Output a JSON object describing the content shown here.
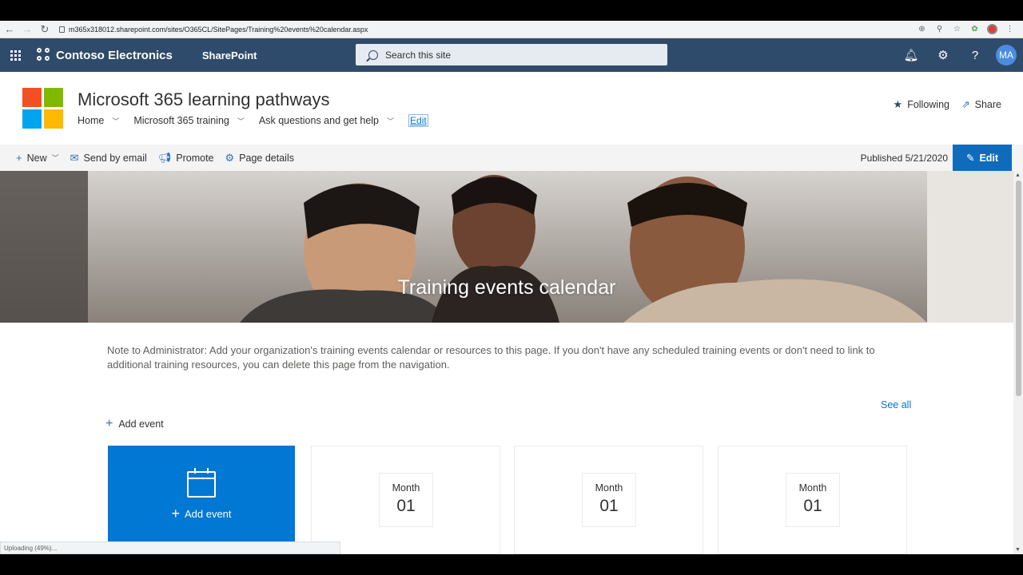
{
  "browser": {
    "url": "m365x318012.sharepoint.com/sites/O365CL/SitePages/Training%20events%20calendar.aspx",
    "status_text": "Uploading (49%)..."
  },
  "suitebar": {
    "org_name": "Contoso Electronics",
    "app_name": "SharePoint",
    "search_placeholder": "Search this site",
    "avatar_initials": "MA"
  },
  "site": {
    "title": "Microsoft 365 learning pathways",
    "nav": [
      "Home",
      "Microsoft 365 training",
      "Ask questions and get help"
    ],
    "edit_link": "Edit",
    "following_label": "Following",
    "share_label": "Share"
  },
  "commandbar": {
    "new_label": "New",
    "send_email_label": "Send by email",
    "promote_label": "Promote",
    "page_details_label": "Page details",
    "published_text": "Published 5/21/2020",
    "edit_label": "Edit"
  },
  "hero": {
    "title": "Training events calendar"
  },
  "main": {
    "note": "Note to Administrator: Add your organization's training events calendar or resources to this page. If you don't have any scheduled training events or don't need to link to additional training resources, you can delete this page from the navigation.",
    "see_all": "See all",
    "add_event_link": "Add event",
    "add_event_tile": "Add event",
    "events": [
      {
        "month": "Month",
        "day": "01"
      },
      {
        "month": "Month",
        "day": "01"
      },
      {
        "month": "Month",
        "day": "01"
      }
    ]
  },
  "colors": {
    "suitebar": "#2f4b6b",
    "accent": "#0078d4"
  }
}
